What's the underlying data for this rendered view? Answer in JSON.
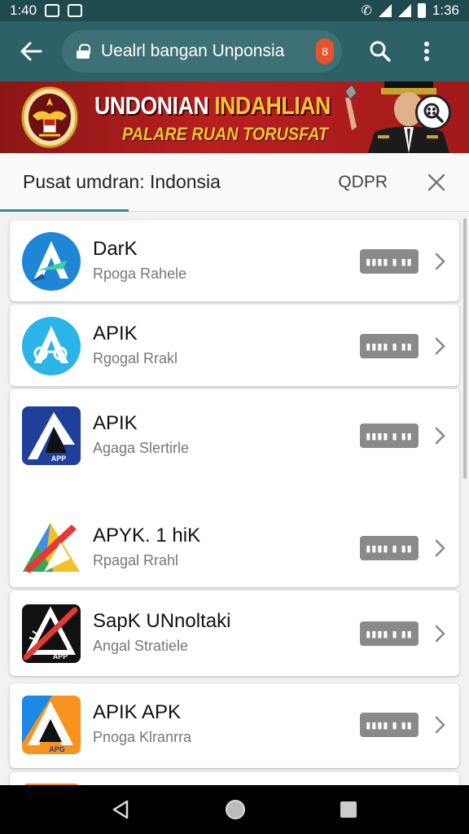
{
  "status_bar": {
    "time_left": "1:40",
    "time_right": "1:36"
  },
  "toolbar": {
    "url": "Uealrl bangan Unponsia",
    "url_badge": "8"
  },
  "banner": {
    "line1_white": "UNDONIAN ",
    "line1_gold": "INDAHLIAN",
    "line2": "PALARE RUAN TORUSFAT"
  },
  "search": {
    "query": "Pusat umdran: Indonsia",
    "extra": "QDPR"
  },
  "apps": [
    {
      "name": "DarK",
      "subtitle": "Rpoga Rahele",
      "button": "▮▮▮▮ ▮ ▮▮"
    },
    {
      "name": "APIK",
      "subtitle": "Rgogal Rrakl",
      "button": "▮▮▮▮ ▮ ▮▮"
    },
    {
      "name": "APIK",
      "subtitle": "Agaga Slertirle",
      "button": "▮▮▮▮ ▮ ▮▮"
    },
    {
      "name": "APYK. 1 hiK",
      "subtitle": "Rpagal Rrahl",
      "button": "▮▮▮▮ ▮ ▮▮"
    },
    {
      "name": "SapK UNnoltaki",
      "subtitle": "Angal Stratiele",
      "button": "▮▮▮▮ ▮ ▮▮"
    },
    {
      "name": "APIK APK",
      "subtitle": "Pnoga Klranrra",
      "button": "▮▮▮▮ ▮ ▮▮"
    }
  ],
  "app_icon_labels": {
    "icon3": "APP",
    "icon5": "APP",
    "icon6": "APG"
  },
  "colors": {
    "status_bar": "#1f4a4f",
    "toolbar": "#2c6167",
    "banner_red": "#b81f1f",
    "banner_gold": "#f6c533",
    "accent_teal": "#2c8f93"
  }
}
